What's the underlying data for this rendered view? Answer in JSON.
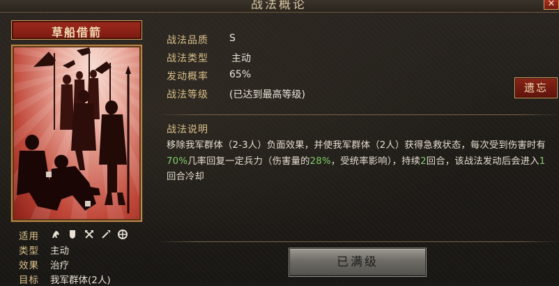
{
  "window": {
    "title": "战法概论",
    "close_label": "✕"
  },
  "skill": {
    "name": "草船借箭",
    "quality_label": "战法品质",
    "quality_value": "S",
    "type_label": "战法类型",
    "type_value": "主动",
    "rate_label": "发动概率",
    "rate_value": "65%",
    "level_label": "战法等级",
    "level_value": "(已达到最高等级)"
  },
  "legacy_button": "遗忘",
  "description": {
    "title": "战法说明",
    "seg1": "移除我军群体（2-3人）负面效果，并使我军群体（2人）获得急救状态，每次受到伤害时有",
    "hl1": "70%",
    "seg2": "几率回复一定兵力（伤害量的",
    "hl2": "28%",
    "seg3": "，受统率影响），持续",
    "hl3": "2",
    "seg4": "回合，该战法发动后会进入",
    "hl4": "1",
    "seg5": "回合冷却"
  },
  "attributes": {
    "applicable_label": "适用",
    "troop_icons": [
      "cavalry-icon",
      "shield-icon",
      "archer-icon",
      "spear-icon",
      "siege-icon"
    ],
    "kind_label": "类型",
    "kind_value": "主动",
    "effect_label": "效果",
    "effect_value": "治疗",
    "target_label": "目标",
    "target_value": "我军群体(2人)"
  },
  "max_button": "已满级",
  "colors": {
    "gold_label": "#d9c08a",
    "highlight_green": "#7fd06a",
    "banner_red": "#9e2a1d"
  }
}
